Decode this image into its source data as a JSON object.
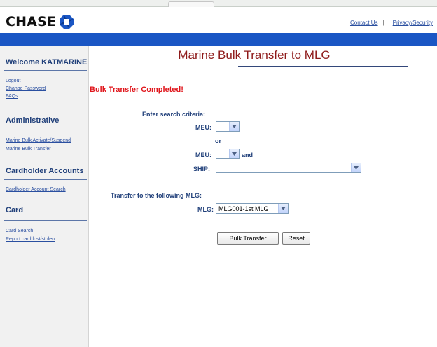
{
  "header": {
    "logo_text": "CHASE",
    "contact_us": "Contact Us",
    "separator": "|",
    "privacy_security": "Privacy/Security"
  },
  "sidebar": {
    "welcome": "Welcome KATMARINE",
    "links_account": [
      "Logout",
      "Change Password",
      "FAQs"
    ],
    "administrative": {
      "heading": "Administrative",
      "links": [
        "Marine Bulk Activate/Suspend",
        "Marine Bulk Transfer"
      ]
    },
    "cardholder_accounts": {
      "heading": "Cardholder Accounts",
      "links": [
        "Cardholder Account Search"
      ]
    },
    "card": {
      "heading": "Card",
      "links": [
        "Card Search",
        "Report card lost/stolen"
      ]
    }
  },
  "main": {
    "title": "Marine Bulk Transfer to MLG",
    "status_message": "Bulk Transfer Completed!",
    "search_criteria_label": "Enter search criteria:",
    "meu_label": "MEU:",
    "meu_value": "",
    "or_text": "or",
    "meu2_label": "MEU:",
    "meu2_value": "",
    "and_text": "and",
    "ship_label": "SHIP:",
    "ship_value": "",
    "transfer_label": "Transfer to the following MLG:",
    "mlg_label": "MLG:",
    "mlg_value": "MLG001-1st MLG",
    "bulk_transfer_button": "Bulk Transfer",
    "reset_button": "Reset"
  },
  "colors": {
    "brand_blue": "#1a56c4",
    "title_red": "#8e1a1a",
    "status_red": "#e0151b",
    "label_navy": "#21407a",
    "link_blue": "#2a4fa0"
  },
  "icons": [
    "chase-octagon-logo-icon",
    "dropdown-arrow-icon"
  ]
}
